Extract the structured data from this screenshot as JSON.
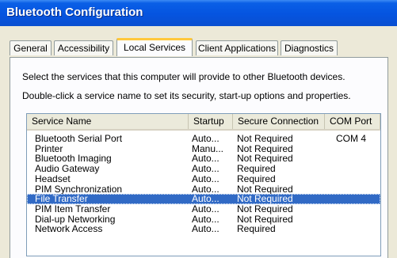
{
  "window": {
    "title": "Bluetooth Configuration"
  },
  "tabs": [
    {
      "label": "General"
    },
    {
      "label": "Accessibility"
    },
    {
      "label": "Local Services"
    },
    {
      "label": "Client Applications"
    },
    {
      "label": "Diagnostics"
    }
  ],
  "active_tab": "Local Services",
  "description": {
    "line1": "Select the services that this computer will provide to other Bluetooth devices.",
    "line2": "Double-click a service name to set its security, start-up options and properties."
  },
  "table": {
    "headers": [
      "Service Name",
      "Startup",
      "Secure Connection",
      "COM Port"
    ],
    "rows": [
      {
        "name": "Bluetooth Serial Port",
        "startup": "Auto...",
        "secure": "Not Required",
        "com": "COM 4"
      },
      {
        "name": "Printer",
        "startup": "Manu...",
        "secure": "Not Required",
        "com": ""
      },
      {
        "name": "Bluetooth Imaging",
        "startup": "Auto...",
        "secure": "Not Required",
        "com": ""
      },
      {
        "name": "Audio Gateway",
        "startup": "Auto...",
        "secure": "Required",
        "com": ""
      },
      {
        "name": "Headset",
        "startup": "Auto...",
        "secure": "Required",
        "com": ""
      },
      {
        "name": "PIM Synchronization",
        "startup": "Auto...",
        "secure": "Not Required",
        "com": ""
      },
      {
        "name": "File Transfer",
        "startup": "Auto...",
        "secure": "Not Required",
        "com": "",
        "selected": true
      },
      {
        "name": "PIM Item Transfer",
        "startup": "Auto...",
        "secure": "Not Required",
        "com": ""
      },
      {
        "name": "Dial-up Networking",
        "startup": "Auto...",
        "secure": "Not Required",
        "com": ""
      },
      {
        "name": "Network Access",
        "startup": "Auto...",
        "secure": "Required",
        "com": ""
      }
    ]
  },
  "colors": {
    "title_bar": "#0554e0",
    "dialog_bg": "#ece9d8",
    "selection": "#316ac5",
    "active_tab_accent": "#ffc83c"
  }
}
